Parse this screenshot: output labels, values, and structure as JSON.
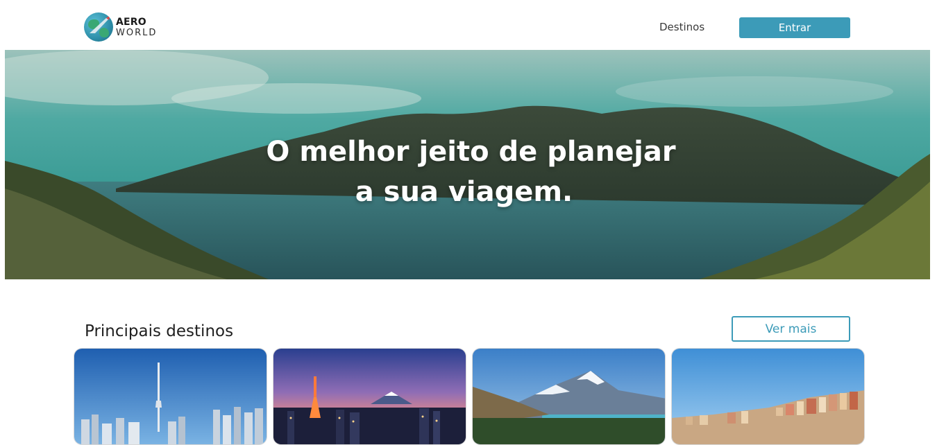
{
  "header": {
    "logo": {
      "line1": "AERO",
      "line2": "WORLD",
      "icon": "globe-plane-icon"
    },
    "nav": {
      "destinos_label": "Destinos"
    },
    "login_label": "Entrar"
  },
  "hero": {
    "title_line1": "O melhor jeito de planejar",
    "title_line2": "a sua viagem."
  },
  "destinations": {
    "title": "Principais destinos",
    "see_more_label": "Ver mais",
    "cards": [
      {
        "image": "toronto-skyline-photo"
      },
      {
        "image": "tokyo-night-fuji-photo"
      },
      {
        "image": "mountain-lake-photo"
      },
      {
        "image": "coastal-city-photo"
      }
    ]
  },
  "colors": {
    "accent": "#3c9bb8",
    "text": "#222222",
    "background": "#ffffff"
  }
}
